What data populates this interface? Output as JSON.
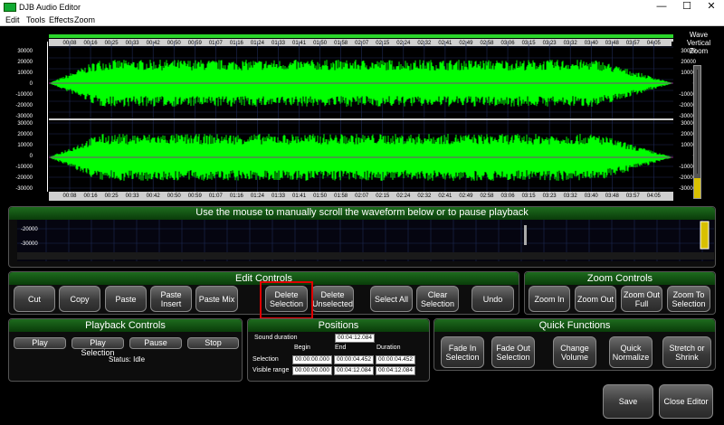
{
  "window": {
    "title": "DJB Audio Editor",
    "minimize": "—",
    "maximize": "☐",
    "close": "✕"
  },
  "menu": [
    "Edit",
    "Tools",
    "Effects",
    "Zoom"
  ],
  "waveform": {
    "time_ticks": [
      "00:08",
      "00:16",
      "00:25",
      "00:33",
      "00:42",
      "00:50",
      "00:59",
      "01:07",
      "01:16",
      "01:24",
      "01:33",
      "01:41",
      "01:50",
      "01:58",
      "02:07",
      "02:15",
      "02:24",
      "02:32",
      "02:41",
      "02:49",
      "02:58",
      "03:06",
      "03:15",
      "03:23",
      "03:32",
      "03:40",
      "03:48",
      "03:57",
      "04:05"
    ],
    "amp_labels_top": [
      "30000",
      "20000",
      "10000",
      "0",
      "-10000",
      "-20000",
      "-30000"
    ],
    "amp_labels_bottom": [
      "30000",
      "20000",
      "10000",
      "0",
      "-10000",
      "-20000",
      "-30000"
    ],
    "wave_color": "#00ff00",
    "zoom_label_1": "Wave",
    "zoom_label_2": "Vertical",
    "zoom_label_3": "Zoom"
  },
  "scroll_panel": {
    "title": "Use the mouse to manually scroll the waveform below or to pause playback",
    "amp_1": "-20000",
    "amp_2": "-30000"
  },
  "edit_controls": {
    "title": "Edit Controls",
    "buttons": [
      {
        "label": "Cut"
      },
      {
        "label": "Copy"
      },
      {
        "label": "Paste"
      },
      {
        "label": "Paste Insert"
      },
      {
        "label": "Paste Mix"
      },
      {
        "label": "Delete Selection"
      },
      {
        "label": "Delete Unselected"
      },
      {
        "label": "Select All"
      },
      {
        "label": "Clear Selection"
      },
      {
        "label": "Undo"
      }
    ]
  },
  "zoom_controls": {
    "title": "Zoom Controls",
    "buttons": [
      {
        "label": "Zoom In"
      },
      {
        "label": "Zoom Out"
      },
      {
        "label": "Zoom Out Full"
      },
      {
        "label": "Zoom To Selection"
      }
    ]
  },
  "playback_controls": {
    "title": "Playback Controls",
    "buttons": [
      {
        "label": "Play"
      },
      {
        "label": "Play Selection"
      },
      {
        "label": "Pause"
      },
      {
        "label": "Stop"
      }
    ],
    "status": "Status: Idle"
  },
  "positions": {
    "title": "Positions",
    "sound_duration_label": "Sound duration",
    "sound_duration": "00:04:12.084",
    "col_begin": "Begin",
    "col_end": "End",
    "col_duration": "Duration",
    "selection_label": "Selection",
    "selection": {
      "begin": "00:00:00.000",
      "end": "00:00:04.452",
      "duration": "00:00:04.452"
    },
    "visible_label": "Visible range",
    "visible": {
      "begin": "00:00:00.000",
      "end": "00:04:12.084",
      "duration": "00:04:12.084"
    }
  },
  "quick_functions": {
    "title": "Quick Functions",
    "buttons": [
      {
        "label": "Fade In Selection"
      },
      {
        "label": "Fade Out Selection"
      },
      {
        "label": "Change Volume"
      },
      {
        "label": "Quick Normalize"
      },
      {
        "label": "Stretch or Shrink"
      }
    ]
  },
  "footer": {
    "save": "Save",
    "close": "Close Editor"
  }
}
